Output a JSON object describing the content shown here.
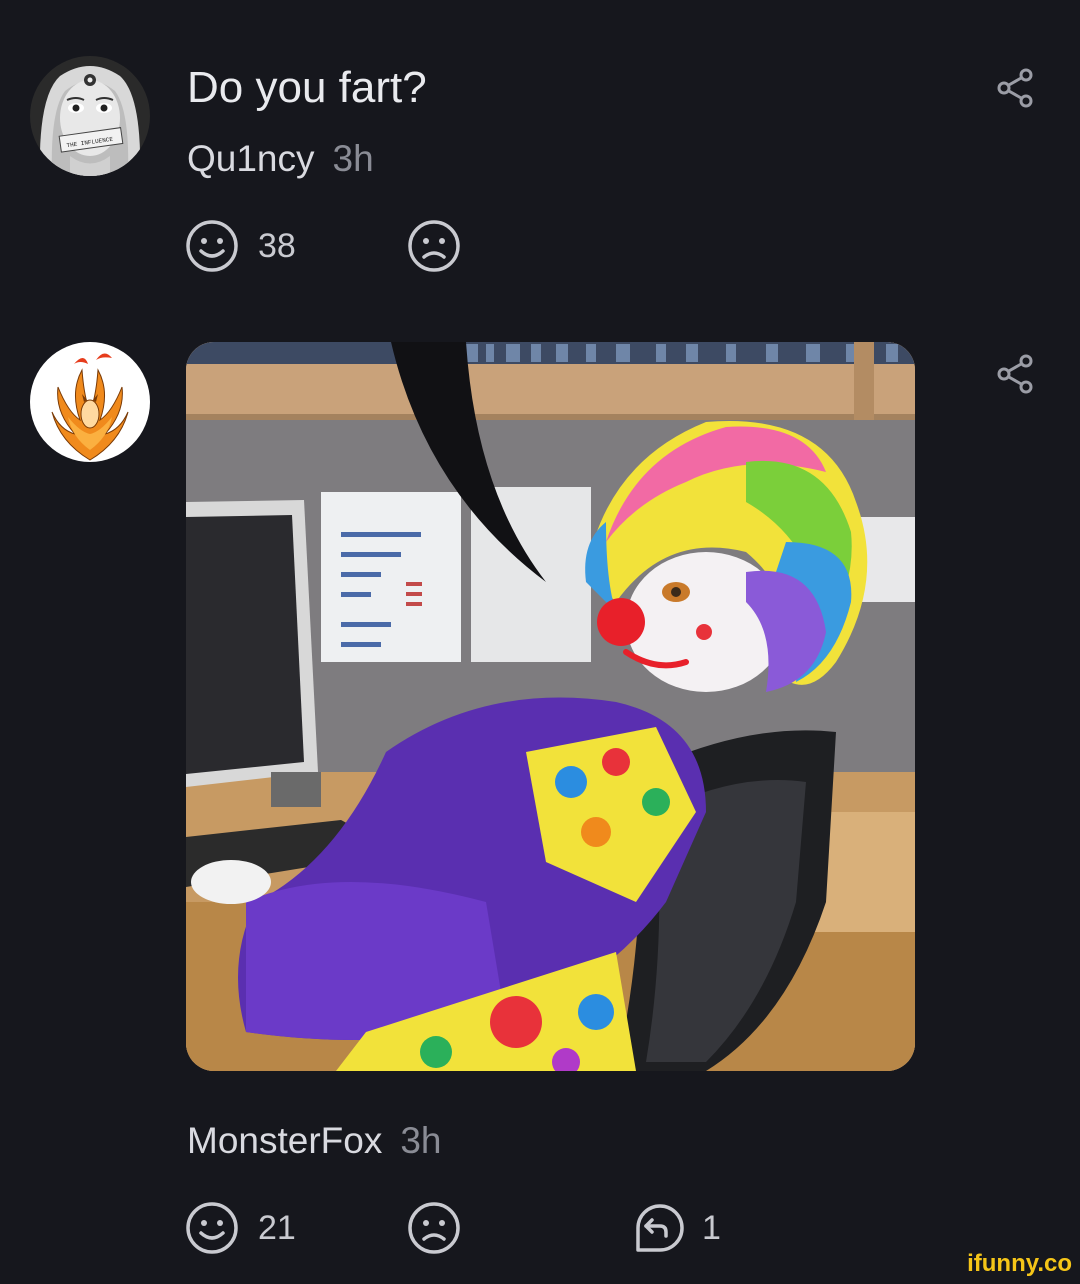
{
  "comments": [
    {
      "text": "Do you fart?",
      "author": "Qu1ncy",
      "time": "3h",
      "likes": "38",
      "avatar_icon": "woman-portrait-avatar",
      "avatar_text": "THE INFLUENCE"
    },
    {
      "author": "MonsterFox",
      "time": "3h",
      "likes": "21",
      "replies": "1",
      "avatar_icon": "nine-tailed-fox-avatar",
      "image_icon": "clown-at-computer-meme"
    }
  ],
  "icons": {
    "share": "share-icon",
    "smile": "smile-icon",
    "frown": "frown-icon",
    "reply": "reply-icon"
  },
  "colors": {
    "background": "#16171d",
    "icon": "#c9cad0",
    "watermark": "#f5c518"
  },
  "watermark": "ifunny.co"
}
